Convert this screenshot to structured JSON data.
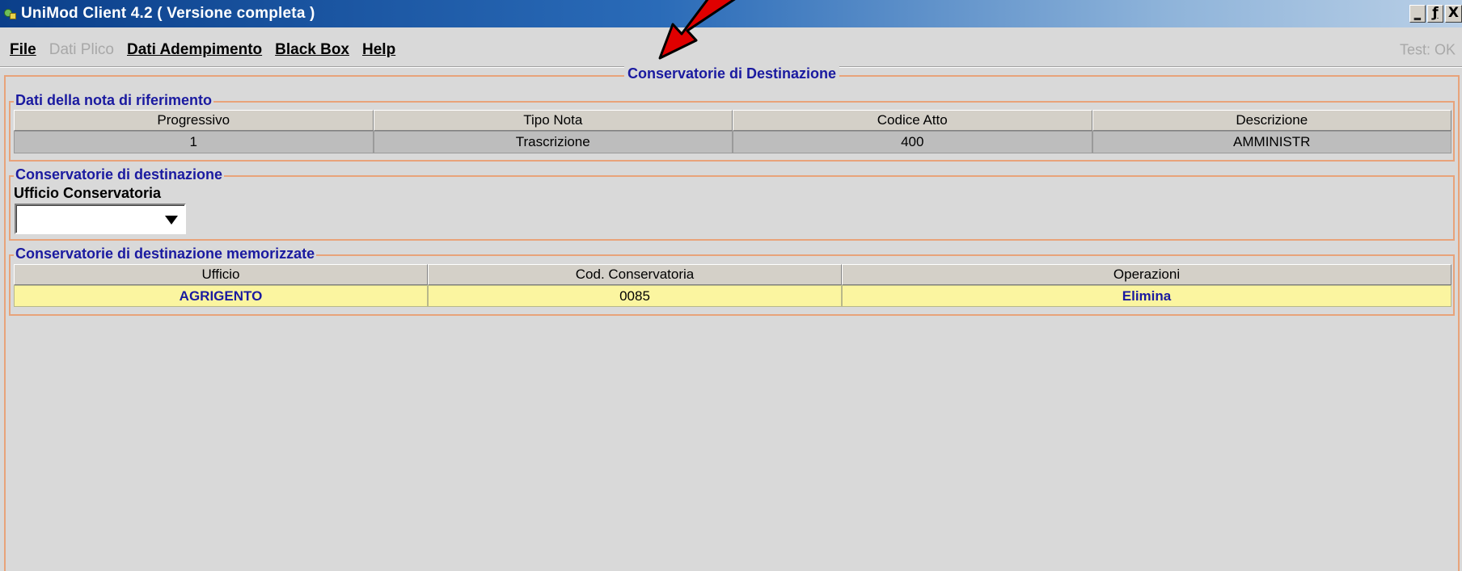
{
  "window": {
    "title": "UniMod Client  4.2  ( Versione completa )",
    "buttons": {
      "minimize": "_",
      "restore": "ƒ",
      "close": "X"
    }
  },
  "menu": {
    "items": [
      {
        "label": "File",
        "enabled": true
      },
      {
        "label": "Dati Plico",
        "enabled": false
      },
      {
        "label": "Dati Adempimento",
        "enabled": true
      },
      {
        "label": "Black Box",
        "enabled": true
      },
      {
        "label": "Help",
        "enabled": true
      }
    ],
    "status": "Test: OK"
  },
  "main": {
    "title": "Conservatorie di Destinazione",
    "nota": {
      "title": "Dati della nota di riferimento",
      "columns": [
        "Progressivo",
        "Tipo Nota",
        "Codice Atto",
        "Descrizione"
      ],
      "row": [
        "1",
        "Trascrizione",
        "400",
        "AMMINISTR"
      ]
    },
    "destinazione": {
      "title": "Conservatorie di destinazione",
      "field_label": "Ufficio Conservatoria",
      "selected_value": ""
    },
    "memorizzate": {
      "title": "Conservatorie di destinazione memorizzate",
      "columns": [
        "Ufficio",
        "Cod. Conservatoria",
        "Operazioni"
      ],
      "row": {
        "ufficio": "AGRIGENTO",
        "codice": "0085",
        "operazione": "Elimina"
      }
    }
  },
  "colors": {
    "accent_text": "#1a1aa0",
    "frame_border": "#e8a37a",
    "highlight_row": "#fbf5a0",
    "annotation_arrow": "#e00000"
  },
  "icons": [
    "app-icon",
    "dropdown-arrow-icon",
    "annotation-arrow"
  ]
}
